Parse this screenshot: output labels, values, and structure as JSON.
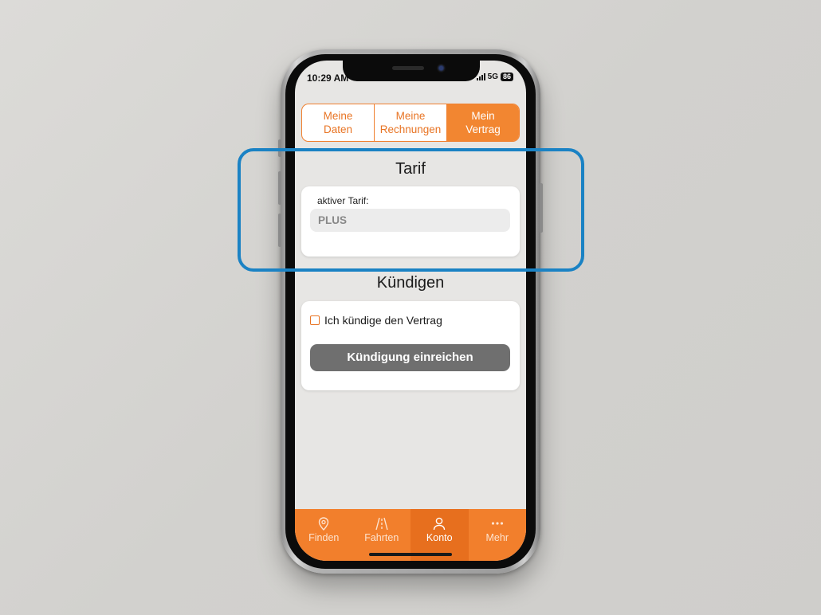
{
  "status_bar": {
    "time": "10:29 AM",
    "network": "5G",
    "battery": "86"
  },
  "tabs": [
    {
      "label": "Meine\nDaten",
      "active": false
    },
    {
      "label": "Meine\nRechnungen",
      "active": false
    },
    {
      "label": "Mein\nVertrag",
      "active": true
    }
  ],
  "tarif": {
    "title": "Tarif",
    "field_label": "aktiver Tarif:",
    "field_value": "PLUS"
  },
  "kuendigen": {
    "title": "Kündigen",
    "checkbox_label": "Ich kündige den Vertrag",
    "checked": false,
    "button_label": "Kündigung einreichen"
  },
  "bottom_nav": [
    {
      "label": "Finden",
      "icon": "location-pin-icon",
      "active": false
    },
    {
      "label": "Fahrten",
      "icon": "road-icon",
      "active": false
    },
    {
      "label": "Konto",
      "icon": "user-icon",
      "active": true
    },
    {
      "label": "Mehr",
      "icon": "more-dots-icon",
      "active": false
    }
  ],
  "colors": {
    "accent": "#f28631",
    "accent_dark": "#e76f1e",
    "highlight": "#1a82c4",
    "button_disabled": "#6f6f6f"
  }
}
